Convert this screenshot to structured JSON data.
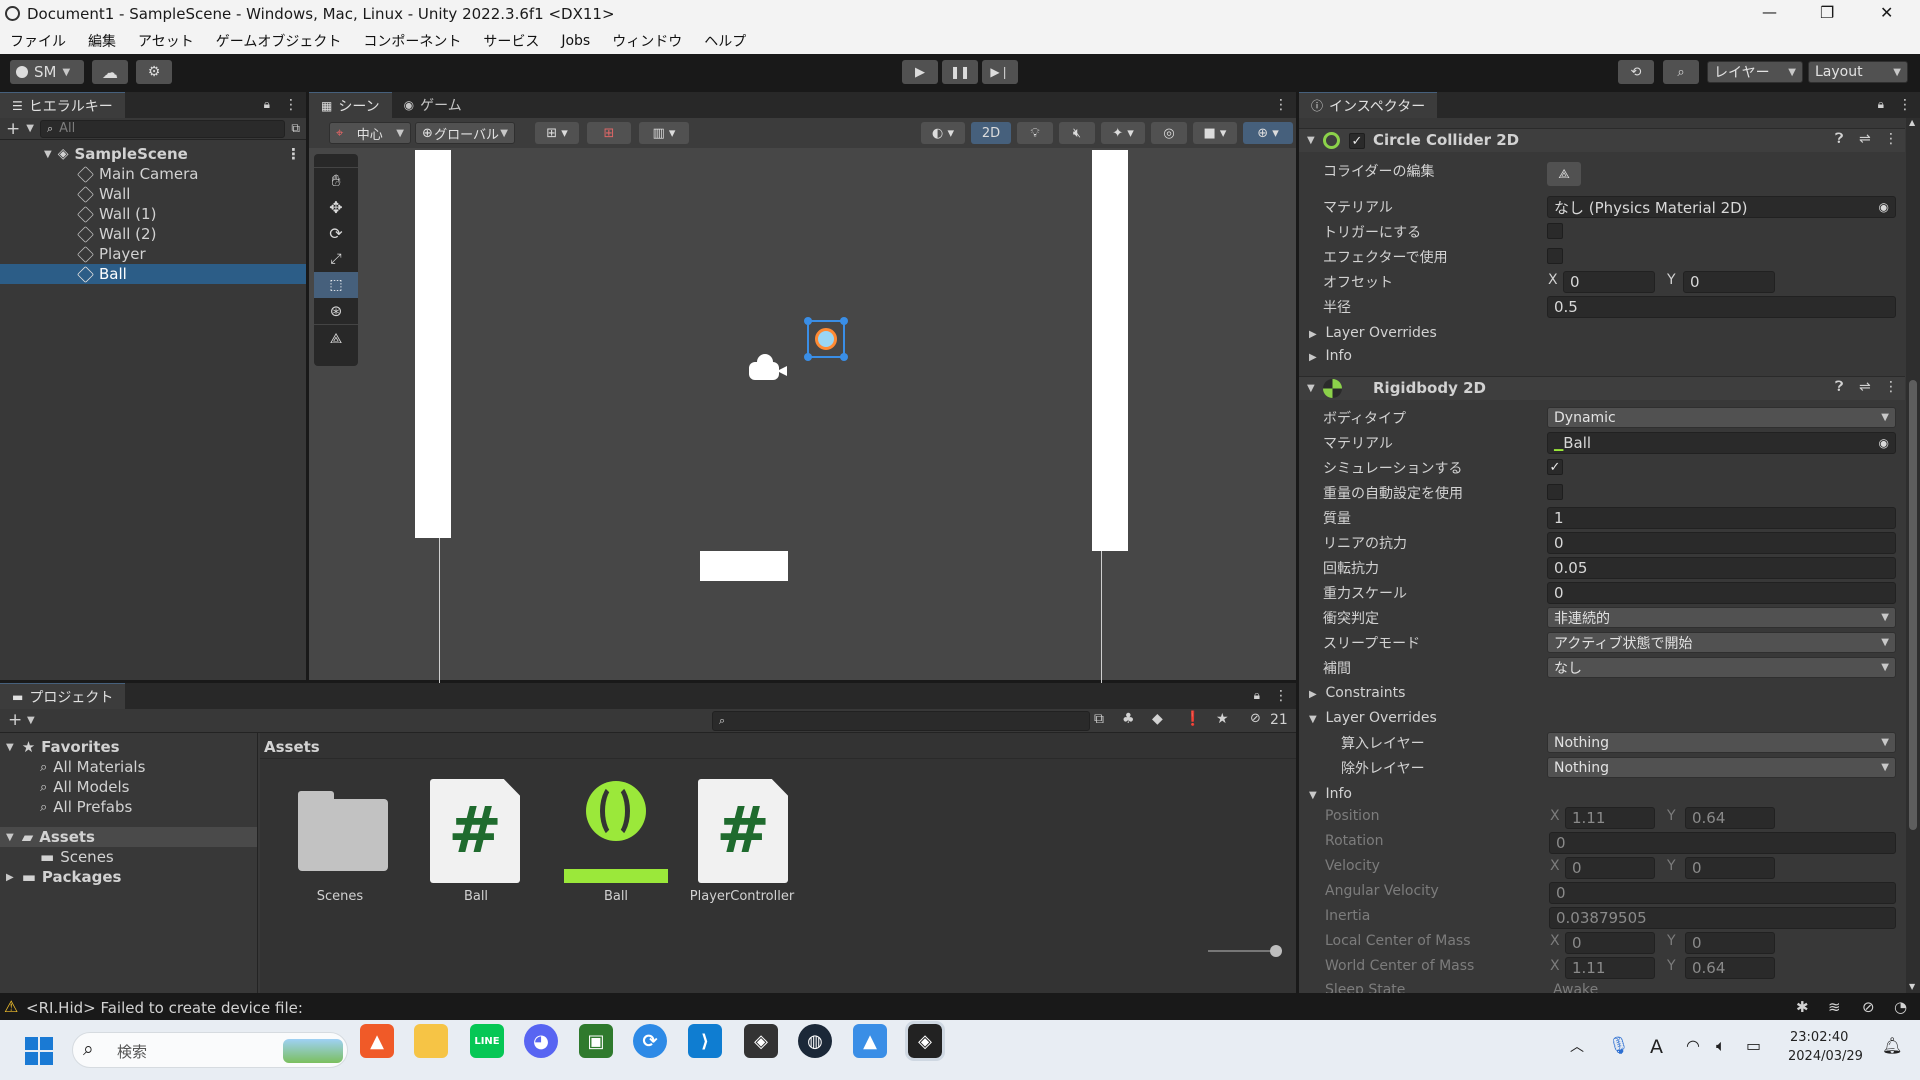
{
  "window": {
    "title": "Document1 - SampleScene - Windows, Mac, Linux - Unity 2022.3.6f1 <DX11>",
    "minimize": "—",
    "restore": "❐",
    "close": "✕"
  },
  "menu": [
    "ファイル",
    "編集",
    "アセット",
    "ゲームオブジェクト",
    "コンポーネント",
    "サービス",
    "Jobs",
    "ウィンドウ",
    "ヘルプ"
  ],
  "toolbar": {
    "account": "SM",
    "layers_label": "レイヤー",
    "layout_label": "Layout"
  },
  "hierarchy": {
    "tab": "ヒエラルキー",
    "search_placeholder": "All",
    "scene": "SampleScene",
    "items": [
      "Main Camera",
      "Wall",
      "Wall (1)",
      "Wall (2)",
      "Player",
      "Ball"
    ],
    "selected": "Ball"
  },
  "scene_view": {
    "tab_scene": "シーン",
    "tab_game": "ゲーム",
    "pivot": "中心",
    "global": "グローバル",
    "mode_2d": "2D"
  },
  "inspector": {
    "tab": "インスペクター",
    "circle_collider": {
      "title": "Circle Collider 2D",
      "enabled": true,
      "edit_label": "コライダーの編集",
      "material_label": "マテリアル",
      "material_value": "なし (Physics Material 2D)",
      "trigger_label": "トリガーにする",
      "effector_label": "エフェクターで使用",
      "offset_label": "オフセット",
      "offset_x": "0",
      "offset_y": "0",
      "radius_label": "半径",
      "radius_value": "0.5",
      "layer_overrides": "Layer Overrides",
      "info": "Info"
    },
    "rigidbody": {
      "title": "Rigidbody 2D",
      "body_type_label": "ボディタイプ",
      "body_type_value": "Dynamic",
      "material_label": "マテリアル",
      "material_value": "Ball",
      "simulated_label": "シミュレーションする",
      "auto_mass_label": "重量の自動設定を使用",
      "mass_label": "質量",
      "mass_value": "1",
      "linear_drag_label": "リニアの抗力",
      "linear_drag_value": "0",
      "angular_drag_label": "回転抗力",
      "angular_drag_value": "0.05",
      "gravity_label": "重力スケール",
      "gravity_value": "0",
      "collision_label": "衝突判定",
      "collision_value": "非連続的",
      "sleep_label": "スリープモード",
      "sleep_value": "アクティブ状態で開始",
      "interp_label": "補間",
      "interp_value": "なし",
      "constraints": "Constraints",
      "layer_overrides": "Layer Overrides",
      "include_label": "算入レイヤー",
      "include_value": "Nothing",
      "exclude_label": "除外レイヤー",
      "exclude_value": "Nothing",
      "info": "Info",
      "position_label": "Position",
      "position_x": "1.11",
      "position_y": "0.64",
      "rotation_label": "Rotation",
      "rotation_value": "0",
      "velocity_label": "Velocity",
      "velocity_x": "0",
      "velocity_y": "0",
      "angular_velocity_label": "Angular Velocity",
      "angular_velocity_value": "0",
      "inertia_label": "Inertia",
      "inertia_value": "0.03879505",
      "local_com_label": "Local Center of Mass",
      "local_com_x": "0",
      "local_com_y": "0",
      "world_com_label": "World Center of Mass",
      "world_com_x": "1.11",
      "world_com_y": "0.64",
      "sleep_state_label": "Sleep State",
      "sleep_state_value": "Awake"
    }
  },
  "project": {
    "tab": "プロジェクト",
    "hidden_count": "21",
    "favorites": "Favorites",
    "fav_items": [
      "All Materials",
      "All Models",
      "All Prefabs"
    ],
    "assets_root": "Assets",
    "scenes_folder": "Scenes",
    "packages": "Packages",
    "breadcrumb": "Assets",
    "assets": [
      "Scenes",
      "Ball",
      "Ball",
      "PlayerController"
    ]
  },
  "status": {
    "message": "<RI.Hid> Failed to create device file:"
  },
  "taskbar": {
    "search_placeholder": "検索",
    "time": "23:02:40",
    "date": "2024/03/29",
    "ime": "A"
  },
  "colors": {
    "selection": "#2c5d87",
    "csharp_green": "#1f6b2e",
    "ball_green": "#9be83a"
  }
}
